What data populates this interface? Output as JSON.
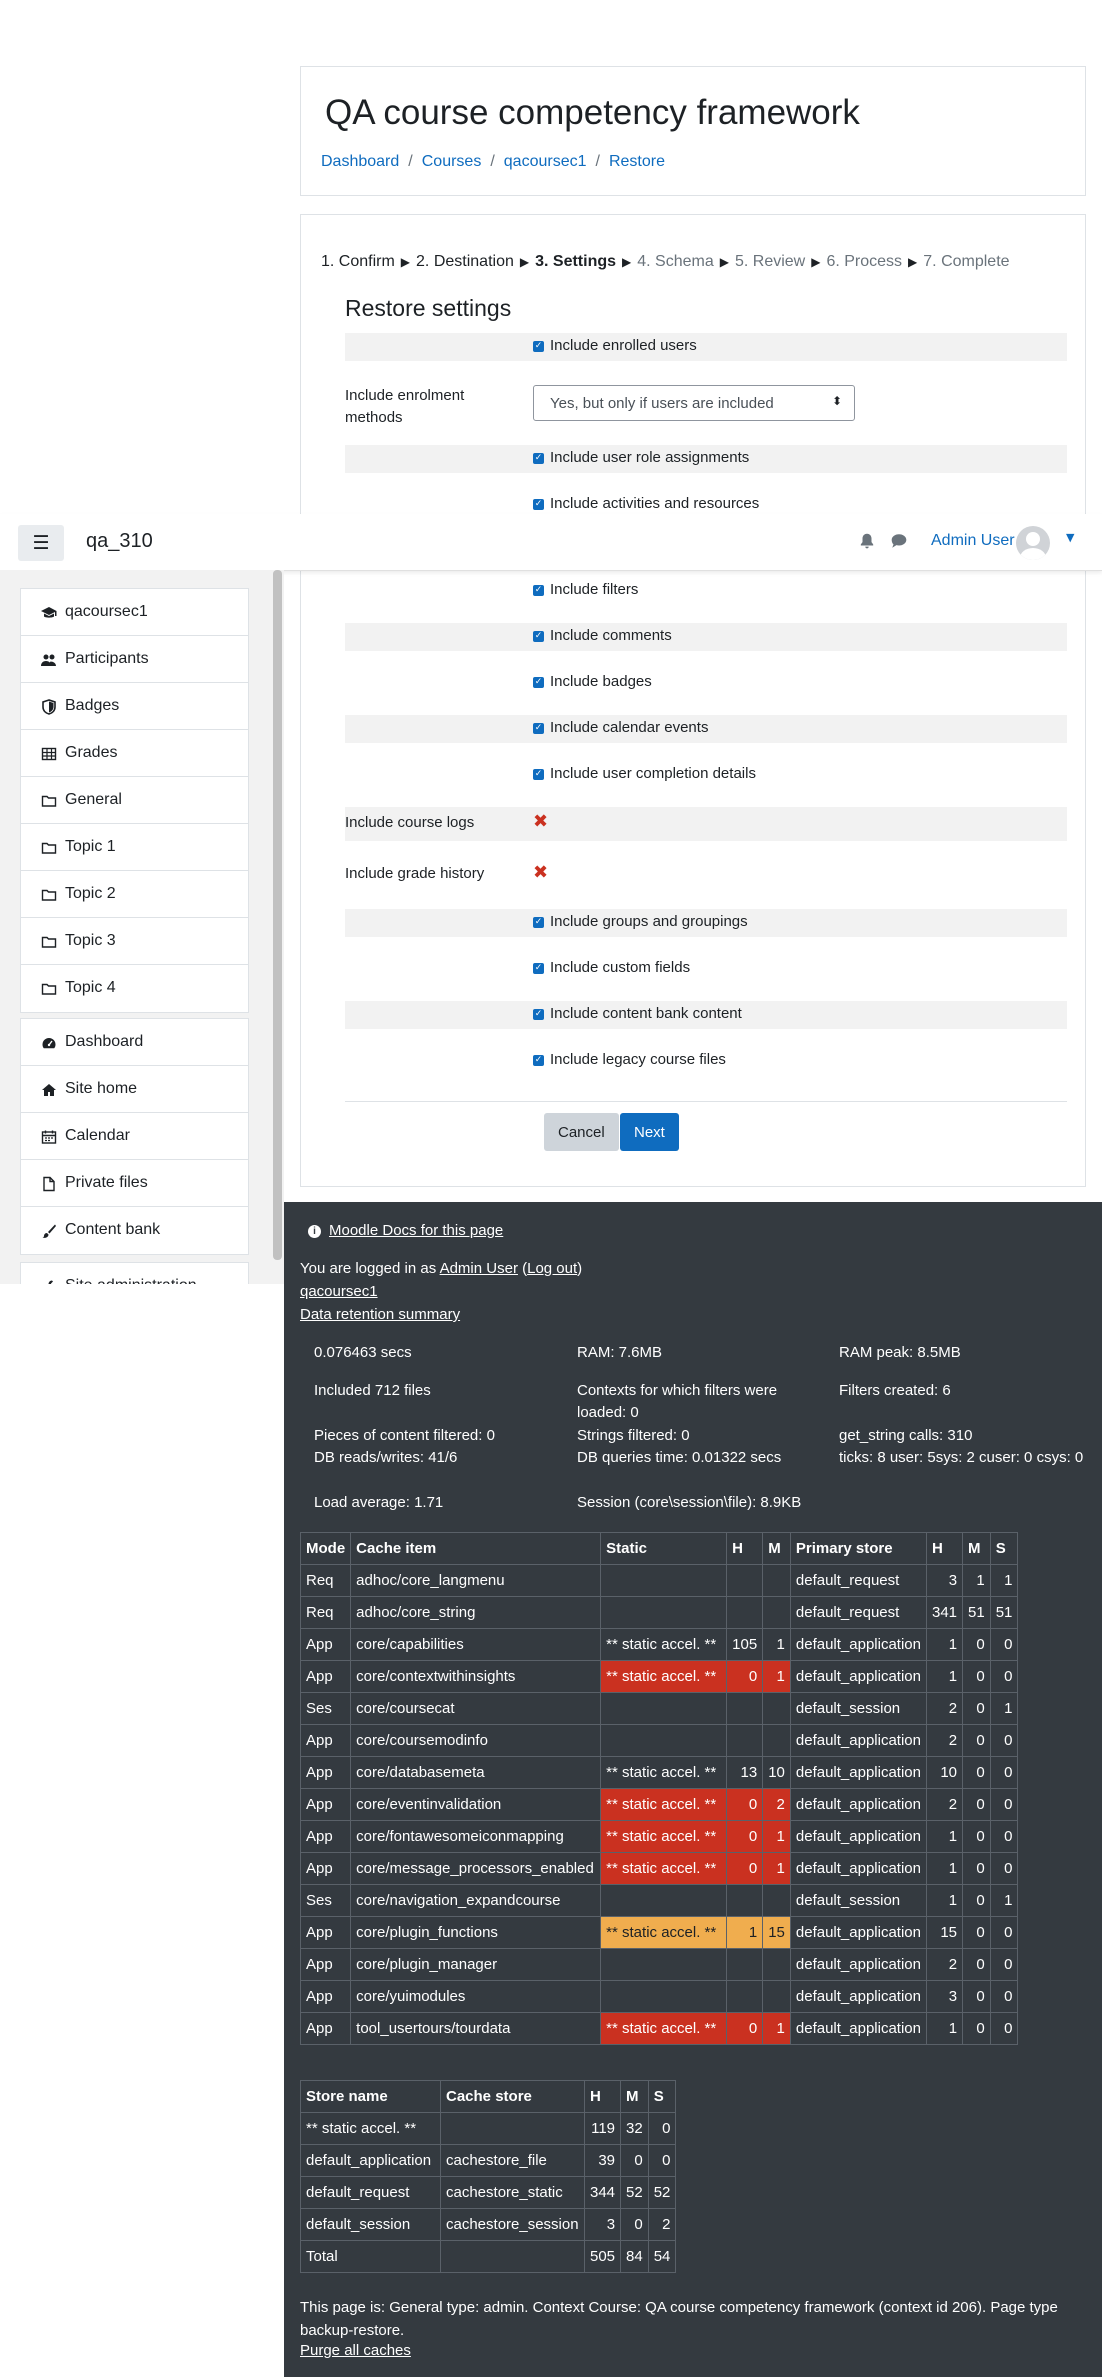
{
  "header": {
    "title": "QA course competency framework",
    "breadcrumb": [
      "Dashboard",
      "Courses",
      "qacoursec1",
      "Restore"
    ]
  },
  "progress": {
    "steps": [
      "1. Confirm",
      "2. Destination",
      "3. Settings",
      "4. Schema",
      "5. Review",
      "6. Process",
      "7. Complete"
    ],
    "current_index": 2
  },
  "form": {
    "heading": "Restore settings",
    "rows_before_navbar": [
      {
        "type": "checkbox",
        "label": "Include enrolled users"
      },
      {
        "type": "select",
        "label": "Include enrolment methods",
        "value": "Yes, but only if users are included"
      },
      {
        "type": "checkbox",
        "label": "Include user role assignments"
      },
      {
        "type": "checkbox",
        "label": "Include activities and resources"
      }
    ],
    "rows_after_navbar": [
      {
        "type": "checkbox",
        "label": "Include filters"
      },
      {
        "type": "checkbox",
        "label": "Include comments"
      },
      {
        "type": "checkbox",
        "label": "Include badges"
      },
      {
        "type": "checkbox",
        "label": "Include calendar events"
      },
      {
        "type": "checkbox",
        "label": "Include user completion details"
      },
      {
        "type": "cross",
        "label": "Include course logs"
      },
      {
        "type": "cross",
        "label": "Include grade history"
      },
      {
        "type": "checkbox",
        "label": "Include groups and groupings"
      },
      {
        "type": "checkbox",
        "label": "Include custom fields"
      },
      {
        "type": "checkbox",
        "label": "Include content bank content"
      },
      {
        "type": "checkbox",
        "label": "Include legacy course files"
      }
    ],
    "cancel_label": "Cancel",
    "next_label": "Next"
  },
  "navbar": {
    "site_name": "qa_310",
    "user_name": "Admin User"
  },
  "drawer": {
    "course_items": [
      {
        "label": "qacoursec1",
        "icon": "graduation-cap-icon"
      },
      {
        "label": "Participants",
        "icon": "users-icon"
      },
      {
        "label": "Badges",
        "icon": "shield-icon"
      },
      {
        "label": "Grades",
        "icon": "table-icon"
      },
      {
        "label": "General",
        "icon": "folder-icon"
      },
      {
        "label": "Topic 1",
        "icon": "folder-icon"
      },
      {
        "label": "Topic 2",
        "icon": "folder-icon"
      },
      {
        "label": "Topic 3",
        "icon": "folder-icon"
      },
      {
        "label": "Topic 4",
        "icon": "folder-icon"
      }
    ],
    "site_items": [
      {
        "label": "Dashboard",
        "icon": "dashboard-icon"
      },
      {
        "label": "Site home",
        "icon": "home-icon"
      },
      {
        "label": "Calendar",
        "icon": "calendar-icon"
      },
      {
        "label": "Private files",
        "icon": "file-icon"
      },
      {
        "label": "Content bank",
        "icon": "paintbrush-icon"
      }
    ],
    "admin_item": {
      "label": "Site administration",
      "icon": "wrench-icon"
    }
  },
  "footer": {
    "docs_link": "Moodle Docs for this page",
    "logged_in_prefix": "You are logged in as ",
    "logged_in_user": "Admin User",
    "logout_label": "Log out",
    "course_link": "qacoursec1",
    "data_retention_link": "Data retention summary",
    "perf": {
      "time": "0.076463 secs",
      "ram": "RAM: 7.6MB",
      "ram_peak": "RAM peak: 8.5MB",
      "files": "Included 712 files",
      "contexts": "Contexts for which filters were loaded: 0",
      "filters_created": "Filters created: 6",
      "content_filtered": "Pieces of content filtered: 0",
      "strings_filtered": "Strings filtered: 0",
      "get_string": "get_string calls: 310",
      "db_rw": "DB reads/writes: 41/6",
      "db_time": "DB queries time: 0.01322 secs",
      "ticks": "ticks: 8 user: 5sys: 2 cuser: 0 csys: 0",
      "load": "Load average: 1.71",
      "session": "Session (core\\session\\file): 8.9KB"
    },
    "cache_table": {
      "headers": [
        "Mode",
        "Cache item",
        "Static",
        "H",
        "M",
        "Primary store",
        "H",
        "M",
        "S"
      ],
      "rows": [
        {
          "mode": "Req",
          "item": "adhoc/core_langmenu",
          "static": "",
          "sh": "",
          "sm": "",
          "status": "",
          "store": "default_request",
          "h": "3",
          "m": "1",
          "s": "1"
        },
        {
          "mode": "Req",
          "item": "adhoc/core_string",
          "static": "",
          "sh": "",
          "sm": "",
          "status": "",
          "store": "default_request",
          "h": "341",
          "m": "51",
          "s": "51"
        },
        {
          "mode": "App",
          "item": "core/capabilities",
          "static": "** static accel. **",
          "sh": "105",
          "sm": "1",
          "status": "",
          "store": "default_application",
          "h": "1",
          "m": "0",
          "s": "0"
        },
        {
          "mode": "App",
          "item": "core/contextwithinsights",
          "static": "** static accel. **",
          "sh": "0",
          "sm": "1",
          "status": "red",
          "store": "default_application",
          "h": "1",
          "m": "0",
          "s": "0"
        },
        {
          "mode": "Ses",
          "item": "core/coursecat",
          "static": "",
          "sh": "",
          "sm": "",
          "status": "",
          "store": "default_session",
          "h": "2",
          "m": "0",
          "s": "1"
        },
        {
          "mode": "App",
          "item": "core/coursemodinfo",
          "static": "",
          "sh": "",
          "sm": "",
          "status": "",
          "store": "default_application",
          "h": "2",
          "m": "0",
          "s": "0"
        },
        {
          "mode": "App",
          "item": "core/databasemeta",
          "static": "** static accel. **",
          "sh": "13",
          "sm": "10",
          "status": "",
          "store": "default_application",
          "h": "10",
          "m": "0",
          "s": "0"
        },
        {
          "mode": "App",
          "item": "core/eventinvalidation",
          "static": "** static accel. **",
          "sh": "0",
          "sm": "2",
          "status": "red",
          "store": "default_application",
          "h": "2",
          "m": "0",
          "s": "0"
        },
        {
          "mode": "App",
          "item": "core/fontawesomeiconmapping",
          "static": "** static accel. **",
          "sh": "0",
          "sm": "1",
          "status": "red",
          "store": "default_application",
          "h": "1",
          "m": "0",
          "s": "0"
        },
        {
          "mode": "App",
          "item": "core/message_processors_enabled",
          "static": "** static accel. **",
          "sh": "0",
          "sm": "1",
          "status": "red",
          "store": "default_application",
          "h": "1",
          "m": "0",
          "s": "0"
        },
        {
          "mode": "Ses",
          "item": "core/navigation_expandcourse",
          "static": "",
          "sh": "",
          "sm": "",
          "status": "",
          "store": "default_session",
          "h": "1",
          "m": "0",
          "s": "1"
        },
        {
          "mode": "App",
          "item": "core/plugin_functions",
          "static": "** static accel. **",
          "sh": "1",
          "sm": "15",
          "status": "orange",
          "store": "default_application",
          "h": "15",
          "m": "0",
          "s": "0"
        },
        {
          "mode": "App",
          "item": "core/plugin_manager",
          "static": "",
          "sh": "",
          "sm": "",
          "status": "",
          "store": "default_application",
          "h": "2",
          "m": "0",
          "s": "0"
        },
        {
          "mode": "App",
          "item": "core/yuimodules",
          "static": "",
          "sh": "",
          "sm": "",
          "status": "",
          "store": "default_application",
          "h": "3",
          "m": "0",
          "s": "0"
        },
        {
          "mode": "App",
          "item": "tool_usertours/tourdata",
          "static": "** static accel. **",
          "sh": "0",
          "sm": "1",
          "status": "red",
          "store": "default_application",
          "h": "1",
          "m": "0",
          "s": "0"
        }
      ]
    },
    "store_table": {
      "headers": [
        "Store name",
        "Cache store",
        "H",
        "M",
        "S"
      ],
      "rows": [
        [
          "** static accel. **",
          "",
          "119",
          "32",
          "0"
        ],
        [
          "default_application",
          "cachestore_file",
          "39",
          "0",
          "0"
        ],
        [
          "default_request",
          "cachestore_static",
          "344",
          "52",
          "52"
        ],
        [
          "default_session",
          "cachestore_session",
          "3",
          "0",
          "2"
        ],
        [
          "Total",
          "",
          "505",
          "84",
          "54"
        ]
      ]
    },
    "page_info": "This page is: General type: admin. Context Course: QA course competency framework (context id 206). Page type backup-restore.",
    "purge_link": "Purge all caches"
  },
  "colors": {
    "brand": "#0f6cbf",
    "footer_bg": "#343a40",
    "miss_red": "#ca3120",
    "partial_orange": "#f0ad4e"
  }
}
